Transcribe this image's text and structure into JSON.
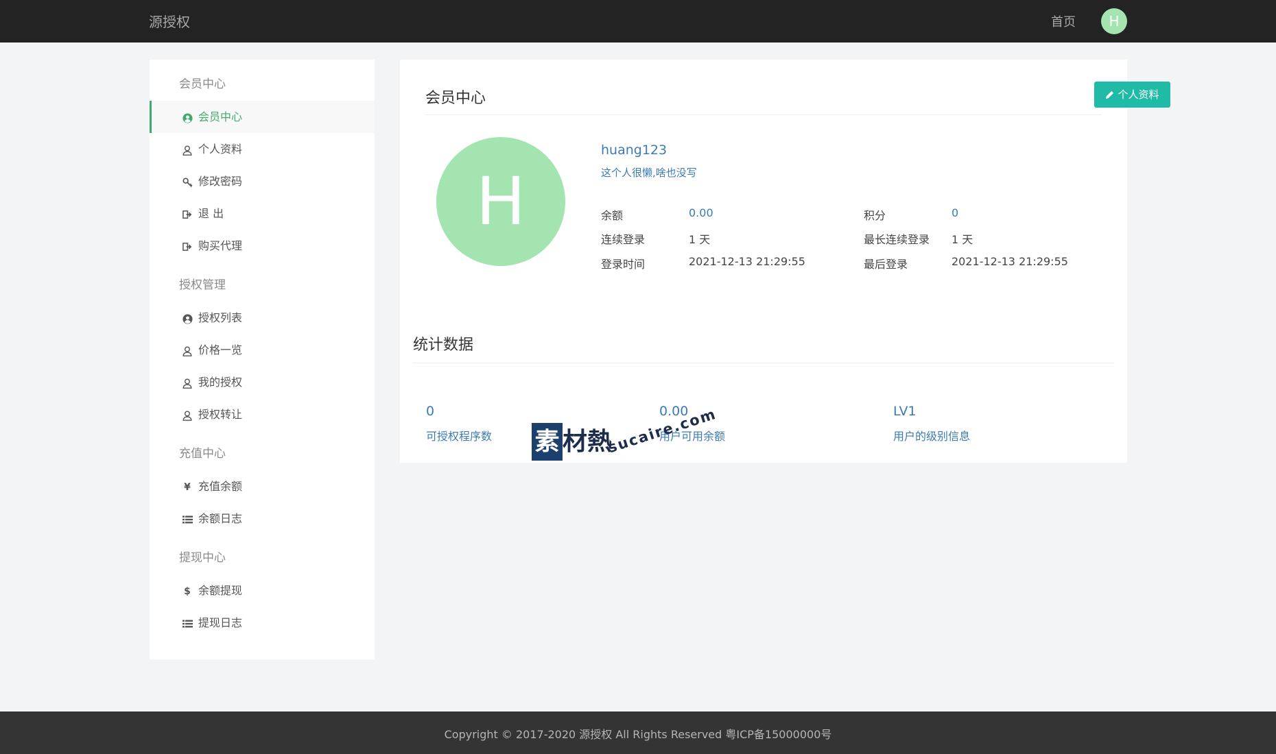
{
  "header": {
    "brand": "源授权",
    "nav_home": "首页",
    "avatar_letter": "H"
  },
  "sidebar": {
    "groups": [
      {
        "title": "会员中心",
        "items": [
          {
            "label": "会员中心",
            "icon": "user-circle-icon",
            "active": true
          },
          {
            "label": "个人资料",
            "icon": "user-icon"
          },
          {
            "label": "修改密码",
            "icon": "key-icon"
          },
          {
            "label": "退 出",
            "icon": "sign-out-icon"
          },
          {
            "label": "购买代理",
            "icon": "sign-out-icon"
          }
        ]
      },
      {
        "title": "授权管理",
        "items": [
          {
            "label": "授权列表",
            "icon": "user-circle-icon"
          },
          {
            "label": "价格一览",
            "icon": "user-icon"
          },
          {
            "label": "我的授权",
            "icon": "user-icon"
          },
          {
            "label": "授权转让",
            "icon": "user-icon"
          }
        ]
      },
      {
        "title": "充值中心",
        "items": [
          {
            "label": "充值余额",
            "icon": "yen-icon"
          },
          {
            "label": "余额日志",
            "icon": "list-icon"
          }
        ]
      },
      {
        "title": "提现中心",
        "items": [
          {
            "label": "余额提现",
            "icon": "dollar-icon"
          },
          {
            "label": "提现日志",
            "icon": "list-icon"
          }
        ]
      }
    ]
  },
  "main": {
    "title": "会员中心",
    "profile_button": "个人资料",
    "avatar_letter": "H",
    "username": "huang123",
    "bio": "这个人很懒,啥也没写",
    "info": [
      {
        "label": "余额",
        "value": "0.00",
        "link": true
      },
      {
        "label": "积分",
        "value": "0",
        "link": true
      },
      {
        "label": "连续登录",
        "value": "1 天",
        "link": false
      },
      {
        "label": "最长连续登录",
        "value": "1 天",
        "link": false
      },
      {
        "label": "登录时间",
        "value": "2021-12-13 21:29:55",
        "link": false
      },
      {
        "label": "最后登录",
        "value": "2021-12-13 21:29:55",
        "link": false
      }
    ],
    "stats_title": "统计数据",
    "stats": [
      {
        "value": "0",
        "label": "可授权程序数"
      },
      {
        "value": "0.00",
        "label": "用户可用余额"
      },
      {
        "value": "LV1",
        "label": "用户的级别信息"
      }
    ]
  },
  "watermark": {
    "box": "素",
    "text": "材熱",
    "url": "sucaire.com"
  },
  "footer": {
    "text": "Copyright © 2017-2020 源授权 All Rights Reserved 粤ICP备15000000号"
  },
  "colors": {
    "accent_green": "#3fab6f",
    "button_teal": "#1fbba6",
    "link_blue": "#3b7bb2",
    "avatar_green": "#a3e4b1"
  }
}
